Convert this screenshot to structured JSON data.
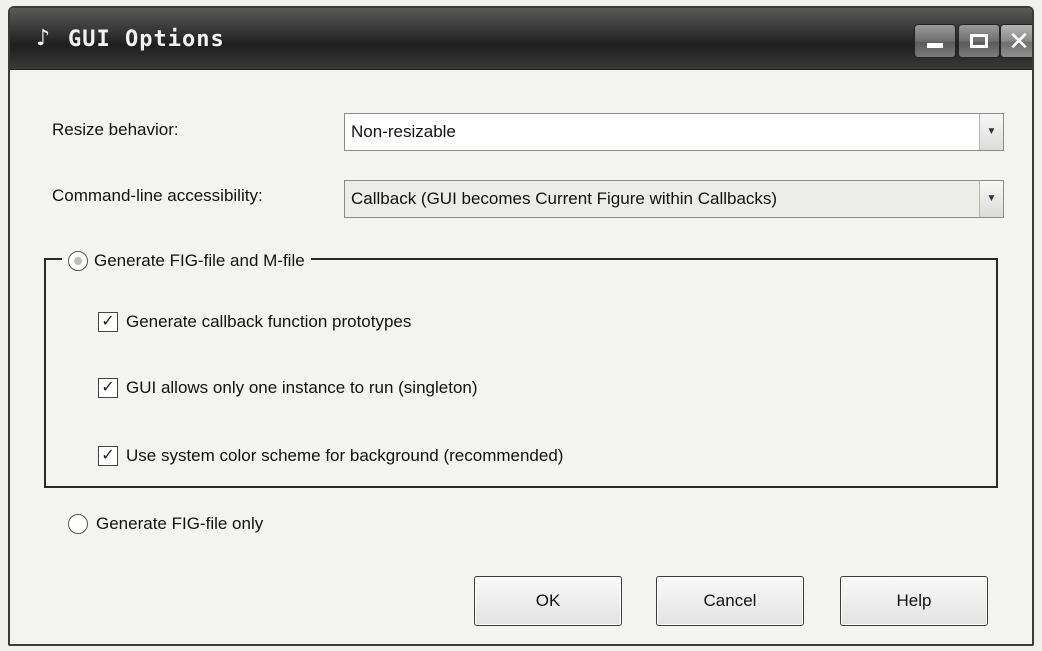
{
  "window": {
    "title": "GUI Options",
    "app_icon": "matlab-logo-icon",
    "controls": {
      "minimize": "minimize-icon",
      "maximize": "maximize-icon",
      "close": "close-icon",
      "close_glyph": "✕"
    }
  },
  "resize": {
    "label": "Resize behavior:",
    "value": "Non-resizable"
  },
  "command_line": {
    "label": "Command-line accessibility:",
    "value": "Callback (GUI becomes Current Figure within Callbacks)"
  },
  "group": {
    "radio_label": "Generate FIG-file and M-file",
    "radio_selected": true,
    "options": [
      {
        "label": "Generate callback function prototypes",
        "checked": true
      },
      {
        "label": "GUI allows only one instance to run (singleton)",
        "checked": true
      },
      {
        "label": "Use system color scheme for background (recommended)",
        "checked": true
      }
    ]
  },
  "fig_only": {
    "label": "Generate FIG-file only",
    "selected": false
  },
  "buttons": {
    "ok": "OK",
    "cancel": "Cancel",
    "help": "Help"
  },
  "glyphs": {
    "check": "✓",
    "dropdown": "▼"
  }
}
